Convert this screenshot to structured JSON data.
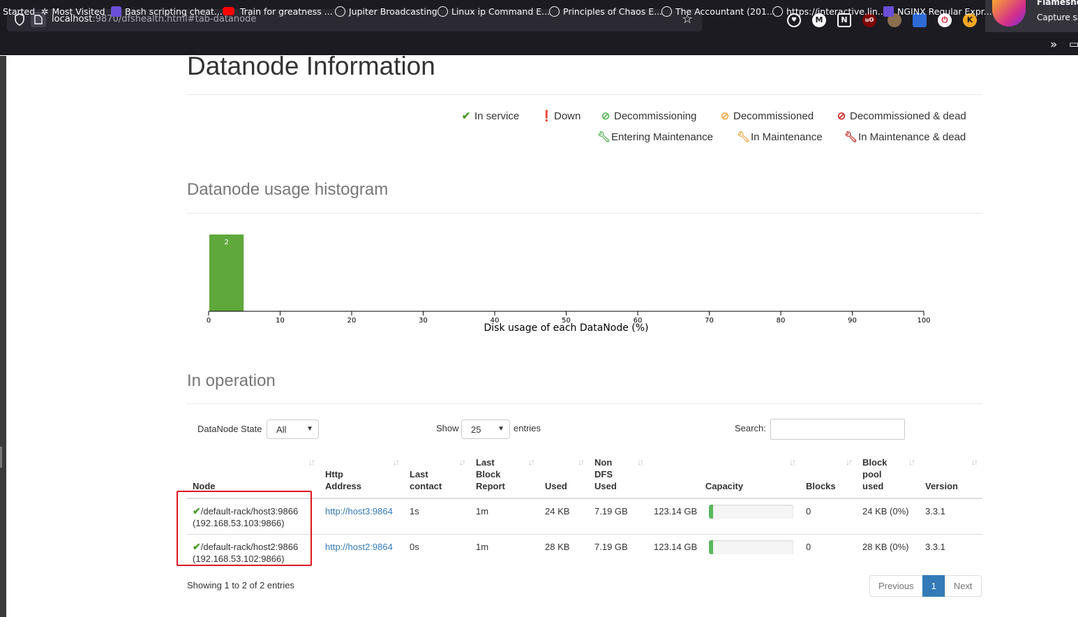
{
  "browser": {
    "url_host": "localhost",
    "url_rest": ":9870/dfshealth.html#tab-datanode",
    "flameshot_title": "Flamesho",
    "flameshot_sub": "Capture sa",
    "bookmarks": [
      {
        "label": "Started",
        "icon": "none"
      },
      {
        "label": "Most Visited",
        "icon": "gear-icon"
      },
      {
        "label": "Bash scripting cheat...",
        "icon": "bookmark-icon"
      },
      {
        "label": "Train for greatness ...",
        "icon": "youtube-icon"
      },
      {
        "label": "Jupiter Broadcasting",
        "icon": "globe-icon"
      },
      {
        "label": "Linux ip Command E...",
        "icon": "globe-icon"
      },
      {
        "label": "Principles of Chaos E...",
        "icon": "globe-icon"
      },
      {
        "label": "The Accountant (201...",
        "icon": "globe-icon"
      },
      {
        "label": "https://interactive.lin...",
        "icon": "globe-icon"
      },
      {
        "label": "NGINX Regular Expr...",
        "icon": "nginx-icon"
      }
    ]
  },
  "page": {
    "title": "Datanode Information",
    "legend": [
      {
        "label": "In service",
        "color": "#4e9a2f",
        "icon": "check-icon"
      },
      {
        "label": "Down",
        "color": "#c9302c",
        "icon": "exclamation-icon"
      },
      {
        "label": "Decommissioning",
        "color": "#5cb85c",
        "icon": "ban-icon"
      },
      {
        "label": "Decommissioned",
        "color": "#f0ad4e",
        "icon": "ban-icon"
      },
      {
        "label": "Decommissioned & dead",
        "color": "#c9302c",
        "icon": "ban-icon"
      },
      {
        "label": "Entering Maintenance",
        "color": "#5cb85c",
        "icon": "wrench-icon"
      },
      {
        "label": "In Maintenance",
        "color": "#f0ad4e",
        "icon": "wrench-icon"
      },
      {
        "label": "In Maintenance & dead",
        "color": "#c9302c",
        "icon": "wrench-icon"
      }
    ],
    "histogram_heading": "Datanode usage histogram",
    "operation_heading": "In operation"
  },
  "chart_data": {
    "type": "bar",
    "bins": [
      [
        0,
        5
      ]
    ],
    "values": [
      2
    ],
    "data_labels": [
      "2"
    ],
    "xlabel": "Disk usage of each DataNode (%)",
    "xlim": [
      0,
      100
    ],
    "xticks": [
      0,
      10,
      20,
      30,
      40,
      50,
      60,
      70,
      80,
      90,
      100
    ],
    "bar_color": "#5fa83b"
  },
  "controls": {
    "state_label": "DataNode State",
    "state_value": "All",
    "show_label": "Show",
    "show_value": "25",
    "entries_label": "entries",
    "search_label": "Search:"
  },
  "table": {
    "headers": [
      "Node",
      "Http Address",
      "Last contact",
      "Last Block Report",
      "Used",
      "Non DFS Used",
      "Capacity",
      "Blocks",
      "Block pool used",
      "Version"
    ],
    "header_lines": [
      [
        "Node"
      ],
      [
        "Http",
        "Address"
      ],
      [
        "Last",
        "contact"
      ],
      [
        "Last",
        "Block",
        "Report"
      ],
      [
        "Used"
      ],
      [
        "Non",
        "DFS",
        "Used"
      ],
      [
        "Capacity"
      ],
      [
        "Blocks"
      ],
      [
        "Block",
        "pool",
        "used"
      ],
      [
        "Version"
      ]
    ],
    "rows": [
      {
        "node": "/default-rack/host3:9866",
        "ip": "(192.168.53.103:9866)",
        "http": "http://host3:9864",
        "last_contact": "1s",
        "last_block_report": "1m",
        "used": "24 KB",
        "non_dfs": "7.19 GB",
        "capacity": "123.14 GB",
        "usage_fraction": 0.05,
        "blocks": "0",
        "block_pool": "24 KB (0%)",
        "version": "3.3.1"
      },
      {
        "node": "/default-rack/host2:9866",
        "ip": "(192.168.53.102:9866)",
        "http": "http://host2:9864",
        "last_contact": "0s",
        "last_block_report": "1m",
        "used": "28 KB",
        "non_dfs": "7.19 GB",
        "capacity": "123.14 GB",
        "usage_fraction": 0.05,
        "blocks": "0",
        "block_pool": "28 KB (0%)",
        "version": "3.3.1"
      }
    ]
  },
  "footer": {
    "showing": "Showing 1 to 2 of 2 entries",
    "prev": "Previous",
    "page": "1",
    "next": "Next"
  }
}
